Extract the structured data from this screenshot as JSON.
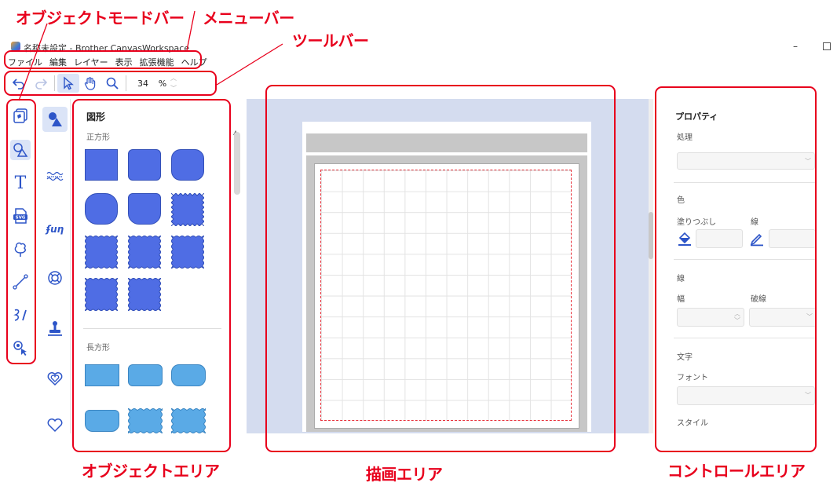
{
  "window": {
    "title": "名称未設定 - Brother CanvasWorkspace",
    "minimize": "–"
  },
  "annotations": {
    "object_mode_bar": "オブジェクトモードバー",
    "menu_bar": "メニューバー",
    "tool_bar": "ツールバー",
    "object_area": "オブジェクトエリア",
    "drawing_area": "描画エリア",
    "control_area": "コントロールエリア",
    "color": "#e8001c"
  },
  "menu": [
    "ファイル",
    "編集",
    "レイヤー",
    "表示",
    "拡張機能",
    "ヘルプ"
  ],
  "toolbar": {
    "icons": [
      "undo-icon",
      "redo-icon",
      "select-pointer-icon",
      "hand-pan-icon",
      "zoom-magnifier-icon"
    ],
    "active": "select-pointer-icon",
    "zoom_value": "34",
    "zoom_unit": "%"
  },
  "mode_bar": {
    "items": [
      "layers-icon",
      "shapes-icon",
      "text-icon",
      "svg-import-icon",
      "tree-pattern-icon",
      "line-icon",
      "pen-draw-icon",
      "trace-tool-icon"
    ],
    "active": "shapes-icon",
    "text_glyph": "T",
    "svg_glyph": "SVG"
  },
  "categories": {
    "items": [
      "shapes-category-icon",
      "border-pattern-icon",
      "fun-text-icon",
      "lifebuoy-frame-icon",
      "stamp-icon",
      "heart-frame-icon",
      "heart-outline-icon"
    ],
    "active": "shapes-category-icon",
    "fun_glyph": "ʄuη"
  },
  "object_area": {
    "title": "図形",
    "square_section": "正方形",
    "rectangle_section": "長方形",
    "accent_square": "#4f6de4",
    "accent_rect": "#5aaae6"
  },
  "properties": {
    "title": "プロパティ",
    "process_label": "処理",
    "color_section": "色",
    "fill_label": "塗りつぶし",
    "stroke_label": "線",
    "line_section": "線",
    "width_label": "幅",
    "dash_label": "破線",
    "text_section": "文字",
    "font_label": "フォント",
    "style_label": "スタイル"
  }
}
